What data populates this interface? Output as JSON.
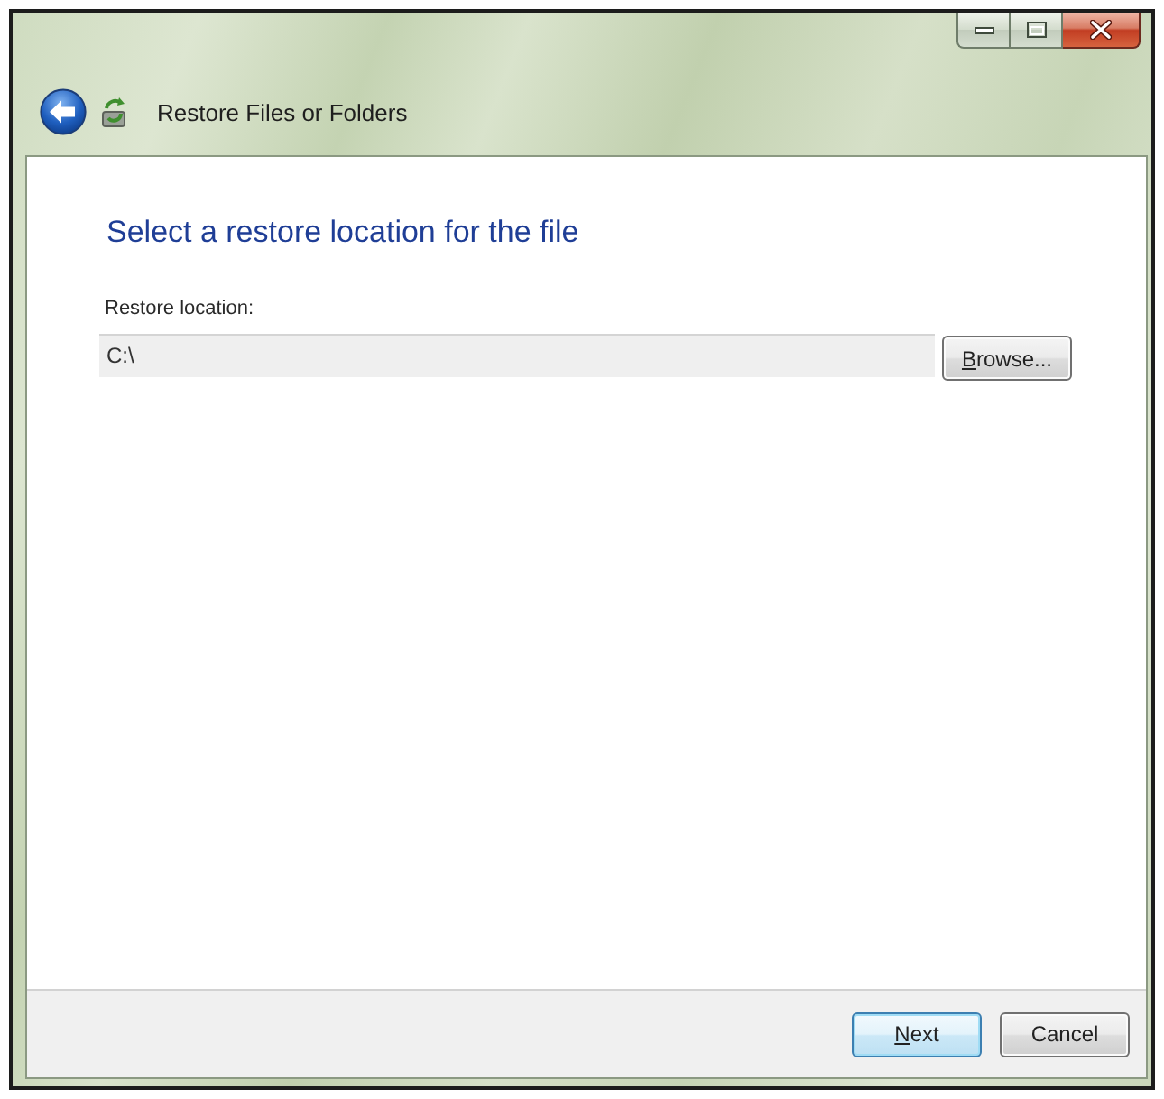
{
  "window": {
    "title": "Restore Files or Folders"
  },
  "page": {
    "heading": "Select a restore location for the file",
    "location": {
      "label": "Restore location:",
      "value": "C:\\",
      "read_only": true,
      "browse": {
        "label": "Browse...",
        "mnemonic": true
      }
    }
  },
  "footer": {
    "buttons": [
      {
        "label": "Next",
        "default": true,
        "mnemonic": true
      },
      {
        "label": "Cancel",
        "default": false,
        "mnemonic": false
      }
    ]
  }
}
